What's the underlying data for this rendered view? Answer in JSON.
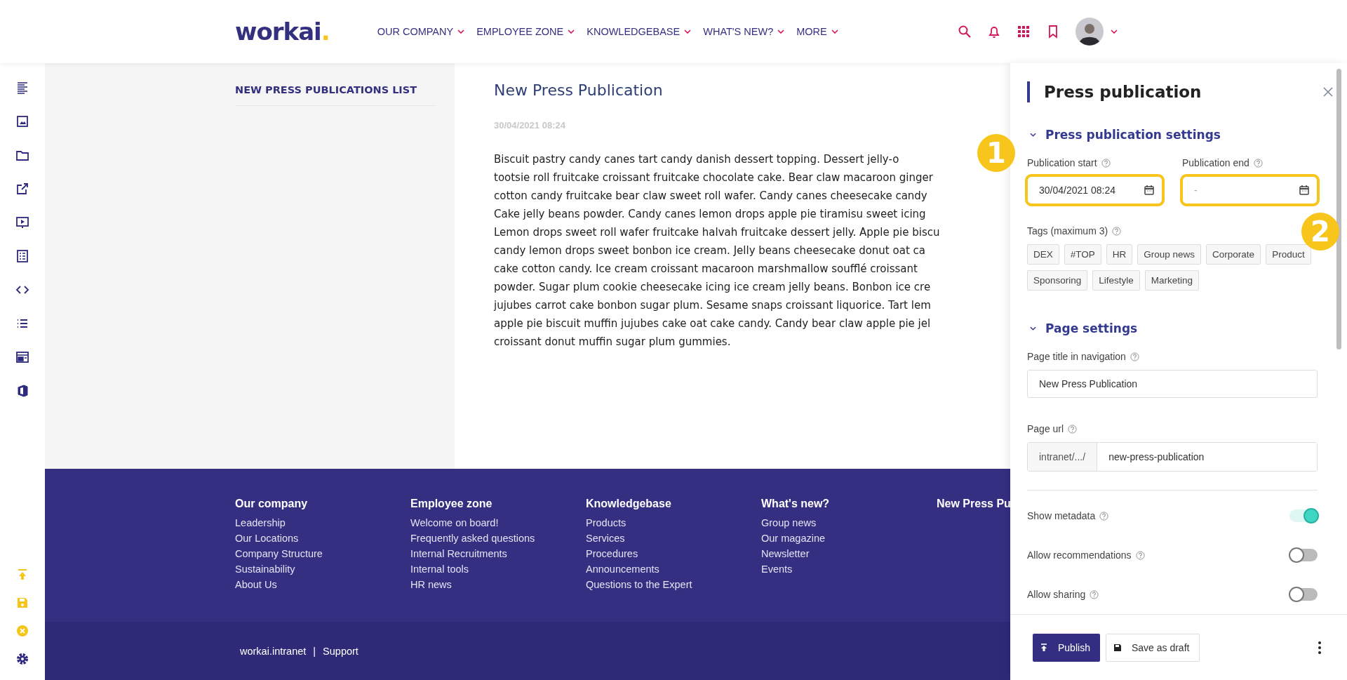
{
  "header": {
    "logo": "workai",
    "logo_dot": ".",
    "nav": [
      {
        "label": "OUR COMPANY"
      },
      {
        "label": "EMPLOYEE ZONE"
      },
      {
        "label": "KNOWLEDGEBASE"
      },
      {
        "label": "WHAT'S NEW?"
      },
      {
        "label": "MORE"
      }
    ]
  },
  "left_column": {
    "heading": "NEW PRESS PUBLICATIONS LIST"
  },
  "article": {
    "title": "New Press Publication",
    "date": "30/04/2021 08:24",
    "lines": [
      "Biscuit pastry candy canes tart candy danish dessert topping. Dessert jelly-o",
      "tootsie roll fruitcake croissant fruitcake chocolate cake. Bear claw macaroon ginger",
      "cotton candy fruitcake bear claw sweet roll wafer. Candy canes cheesecake candy",
      "Cake jelly beans powder. Candy canes lemon drops apple pie tiramisu sweet icing",
      "Lemon drops sweet roll wafer fruitcake halvah fruitcake dessert jelly. Apple pie biscu",
      "candy lemon drops sweet bonbon ice cream. Jelly beans cheesecake donut oat ca",
      "cake cotton candy. Ice cream croissant macaroon marshmallow soufflé croissant",
      "powder. Sugar plum cookie cheesecake icing ice cream jelly beans. Bonbon ice cre",
      "jujubes carrot cake bonbon sugar plum. Sesame snaps croissant liquorice. Tart lem",
      "apple pie biscuit muffin jujubes cake oat cake candy. Candy bear claw apple pie jel",
      "croissant donut muffin sugar plum gummies."
    ]
  },
  "footer": {
    "columns": [
      {
        "heading": "Our company",
        "links": [
          "Leadership",
          "Our Locations",
          "Company Structure",
          "Sustainability",
          "About Us"
        ]
      },
      {
        "heading": "Employee zone",
        "links": [
          "Welcome on board!",
          "Frequently asked questions",
          "Internal Recruitments",
          "Internal tools",
          "HR news"
        ]
      },
      {
        "heading": "Knowledgebase",
        "links": [
          "Products",
          "Services",
          "Procedures",
          "Announcements",
          "Questions to the Expert"
        ]
      },
      {
        "heading": "What's new?",
        "links": [
          "Group news",
          "Our magazine",
          "Newsletter",
          "Events"
        ]
      },
      {
        "heading": "New Press Pu"
      }
    ],
    "brand": "workai.intranet",
    "separator": "|",
    "support": "Support"
  },
  "panel": {
    "title": "Press publication",
    "sections": [
      {
        "title": "Press publication settings",
        "expanded": true
      },
      {
        "title": "Page settings",
        "expanded": true
      }
    ],
    "date_fields": [
      {
        "label": "Publication start",
        "value": "30/04/2021 08:24",
        "annotation": "1"
      },
      {
        "label": "Publication end",
        "placeholder": "-",
        "annotation": "2"
      }
    ],
    "tags_label": "Tags (maximum 3)",
    "tags": [
      "DEX",
      "#TOP",
      "HR",
      "Group news",
      "Corporate",
      "Product",
      "Sponsoring",
      "Lifestyle",
      "Marketing"
    ],
    "page_title": {
      "label": "Page title in navigation",
      "value": "New Press Publication"
    },
    "page_url": {
      "label": "Page url",
      "prefix": "intranet/.../",
      "value": "new-press-publication"
    },
    "toggles": [
      {
        "label": "Show metadata",
        "on": true
      },
      {
        "label": "Allow recommendations",
        "on": false
      },
      {
        "label": "Allow sharing",
        "on": false
      }
    ],
    "actions": [
      {
        "label": "Publish",
        "kind": "primary"
      },
      {
        "label": "Save as draft",
        "kind": "secondary"
      }
    ]
  }
}
